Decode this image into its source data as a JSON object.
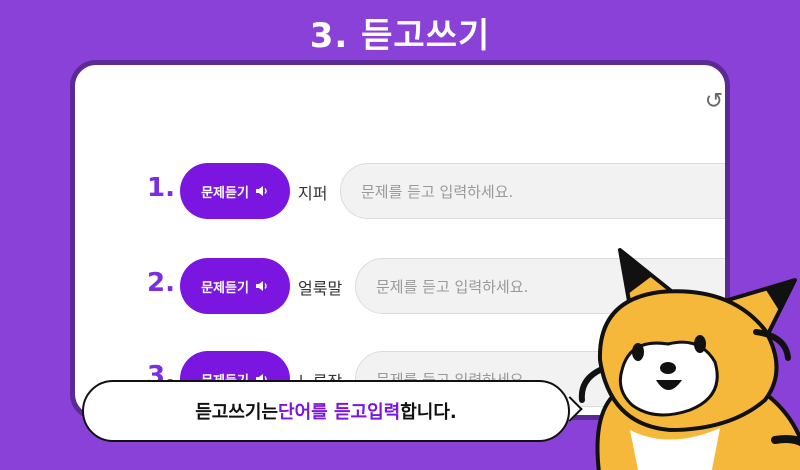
{
  "header": {
    "title": "3. 듣고쓰기"
  },
  "colors": {
    "background": "#8a41d8",
    "accent": "#7a16e0",
    "number": "#7a2ee0"
  },
  "toolbar": {
    "refresh_icon": "refresh-icon"
  },
  "questions": [
    {
      "number": "1.",
      "button_label": "문제듣기",
      "word": "지퍼",
      "input_placeholder": "문제를 듣고 입력하세요."
    },
    {
      "number": "2.",
      "button_label": "문제듣기",
      "word": "얼룩말",
      "input_placeholder": "문제를 듣고 입력하세요."
    },
    {
      "number": "3.",
      "button_label": "문제듣기",
      "word": "노루장",
      "input_placeholder": "문제를 듣고 입력하세요."
    }
  ],
  "tooltip": {
    "part1": "듣고쓰기는 ",
    "highlight1": "단어를 듣고",
    "space": " ",
    "highlight2": "입력",
    "part2": "합니다."
  }
}
